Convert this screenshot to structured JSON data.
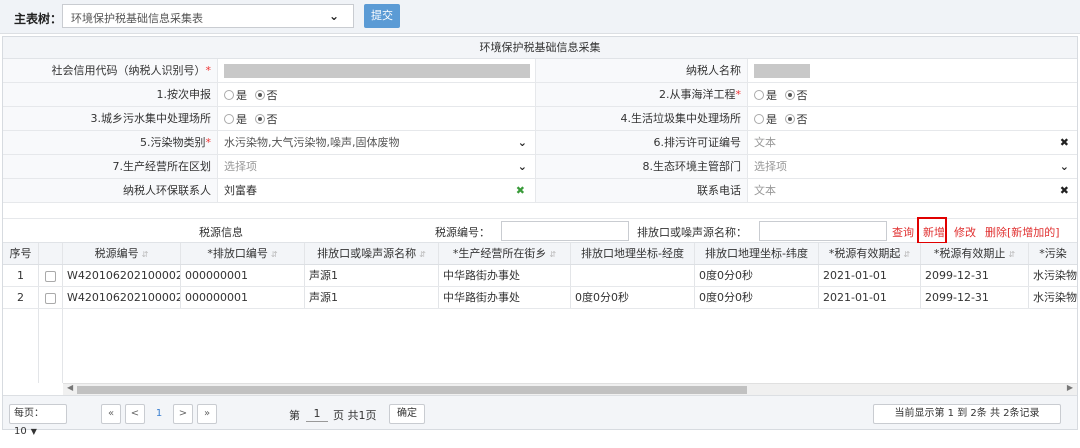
{
  "toolbar": {
    "main_tree_label": "主表树：",
    "main_tree_value": "环境保护税基础信息采集表",
    "submit_label": "提交"
  },
  "form": {
    "title": "环境保护税基础信息采集",
    "credit_code_label": "社会信用代码（纳税人识别号）",
    "taxpayer_name_label": "纳税人名称",
    "q1_label": "1.按次申报",
    "q2_label": "2.从事海洋工程",
    "q3_label": "3.城乡污水集中处理场所",
    "q4_label": "4.生活垃圾集中处理场所",
    "yes": "是",
    "no": "否",
    "q5_label": "5.污染物类别",
    "q5_value": "水污染物,大气污染物,噪声,固体废物",
    "q6_label": "6.排污许可证编号",
    "q6_placeholder": "文本",
    "q7_label": "7.生产经营所在区划",
    "q7_placeholder": "选择项",
    "q8_label": "8.生态环境主管部门",
    "q8_placeholder": "选择项",
    "contact_label": "纳税人环保联系人",
    "contact_value": "刘富春",
    "phone_label": "联系电话",
    "phone_placeholder": "文本",
    "required_mark": "*"
  },
  "source_bar": {
    "title": "税源信息",
    "source_no_label": "税源编号：",
    "outlet_name_label": "排放口或噪声源名称：",
    "query": "查询",
    "add": "新增",
    "edit": "修改",
    "delete_new": "删除[新增加的]"
  },
  "grid": {
    "columns": [
      "序号",
      "税源编号",
      "*排放口编号",
      "排放口或噪声源名称",
      "*生产经营所在街乡",
      "排放口地理坐标-经度",
      "排放口地理坐标-纬度",
      "*税源有效期起",
      "*税源有效期止",
      "*污染"
    ],
    "rows": [
      [
        "1",
        "W420106202100002",
        "000000001",
        "声源1",
        "中华路街办事处",
        "",
        "0度0分0秒",
        "2021-01-01",
        "2099-12-31",
        "水污染物"
      ],
      [
        "2",
        "W420106202100002",
        "000000001",
        "声源1",
        "中华路街办事处",
        "0度0分0秒",
        "0度0分0秒",
        "2021-01-01",
        "2099-12-31",
        "水污染物"
      ]
    ]
  },
  "pager": {
    "per_page_label": "每页：",
    "per_page_value": "10",
    "first": "«",
    "prev": "<",
    "page1": "1",
    "next": ">",
    "last": "»",
    "page_prefix": "第",
    "page_value": "1",
    "page_suffix": "页 共1页",
    "confirm": "确定",
    "status": "当前显示第 1 到 2条 共 2条记录"
  }
}
